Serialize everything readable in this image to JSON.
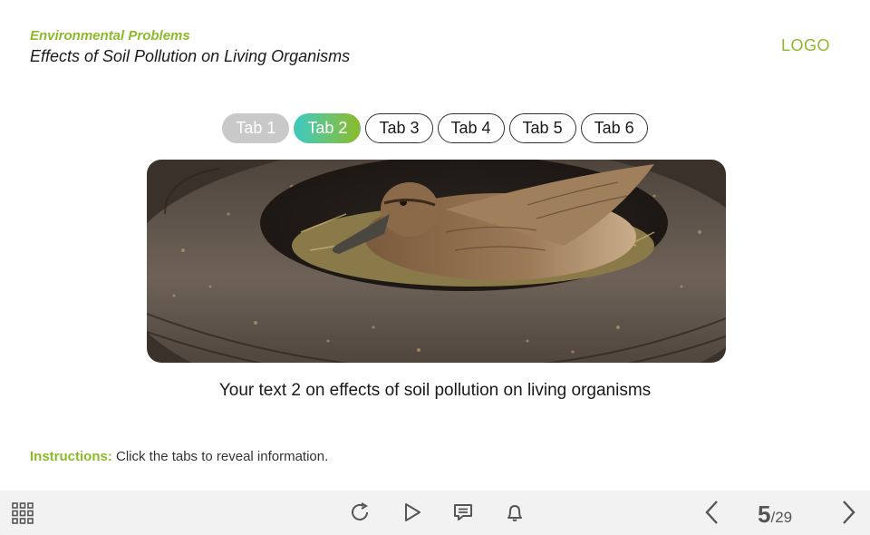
{
  "header": {
    "course_title": "Environmental Problems",
    "slide_title": "Effects of Soil Pollution on Living Organisms",
    "logo": "LOGO"
  },
  "tabs": [
    {
      "label": "Tab 1",
      "state": "visited"
    },
    {
      "label": "Tab 2",
      "state": "active"
    },
    {
      "label": "Tab 3",
      "state": "default"
    },
    {
      "label": "Tab 4",
      "state": "default"
    },
    {
      "label": "Tab 5",
      "state": "default"
    },
    {
      "label": "Tab 6",
      "state": "default"
    }
  ],
  "content": {
    "image_subject": "duck nesting in an old tire",
    "caption": "Your text 2 on effects of soil pollution on living organisms"
  },
  "instructions": {
    "label": "Instructions:",
    "text": "Click the tabs to reveal information."
  },
  "toolbar": {
    "menu_icon": "grid-menu-icon",
    "replay_icon": "replay-icon",
    "play_icon": "play-icon",
    "notes_icon": "notes-icon",
    "notify_icon": "bell-icon",
    "prev_icon": "chevron-left-icon",
    "next_icon": "chevron-right-icon",
    "current_page": "5",
    "total_pages": "/29"
  },
  "colors": {
    "accent_green": "#8cba2a",
    "active_tab_start": "#3cc9c4",
    "active_tab_end": "#8cba2a",
    "visited_tab": "#c9c9c9",
    "toolbar_bg": "#f2f2f2"
  }
}
